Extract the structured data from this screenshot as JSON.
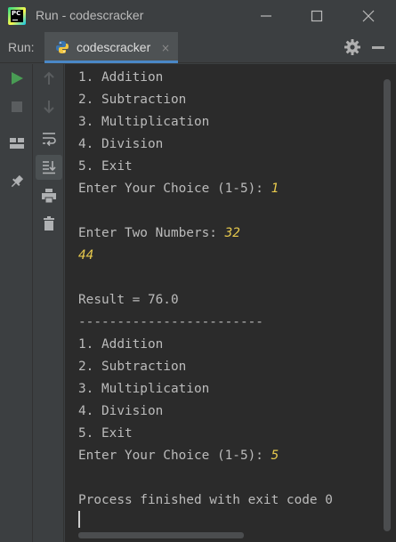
{
  "window": {
    "title": "Run - codescracker"
  },
  "toolbar": {
    "run_label": "Run:",
    "tab_label": "codescracker",
    "tab_close": "×"
  },
  "icons": {
    "run": "play-icon",
    "stop": "stop-icon",
    "layout": "layout-icon",
    "pin": "pin-icon",
    "up": "arrow-up-icon",
    "down": "arrow-down-icon",
    "wrap": "soft-wrap-icon",
    "scroll_end": "scroll-to-end-icon",
    "print": "print-icon",
    "trash": "trash-icon",
    "settings": "gear-icon",
    "hide": "minimize-panel-icon"
  },
  "colors": {
    "run_green": "#499c54",
    "input_yellow": "#e6c84d",
    "console_bg": "#2b2b2b",
    "chrome_bg": "#3c3f41",
    "tab_accent": "#4a88c7"
  },
  "console": {
    "lines": [
      {
        "text": "1. Addition",
        "input": ""
      },
      {
        "text": "2. Subtraction",
        "input": ""
      },
      {
        "text": "3. Multiplication",
        "input": ""
      },
      {
        "text": "4. Division",
        "input": ""
      },
      {
        "text": "5. Exit",
        "input": ""
      },
      {
        "text": "Enter Your Choice (1-5): ",
        "input": "1"
      },
      {
        "text": "",
        "input": ""
      },
      {
        "text": "Enter Two Numbers: ",
        "input": "32"
      },
      {
        "text": "",
        "input": "44"
      },
      {
        "text": "",
        "input": ""
      },
      {
        "text": "Result = 76.0",
        "input": ""
      },
      {
        "text": "------------------------",
        "input": ""
      },
      {
        "text": "1. Addition",
        "input": ""
      },
      {
        "text": "2. Subtraction",
        "input": ""
      },
      {
        "text": "3. Multiplication",
        "input": ""
      },
      {
        "text": "4. Division",
        "input": ""
      },
      {
        "text": "5. Exit",
        "input": ""
      },
      {
        "text": "Enter Your Choice (1-5): ",
        "input": "5"
      },
      {
        "text": "",
        "input": ""
      },
      {
        "text": "Process finished with exit code 0",
        "input": ""
      }
    ]
  }
}
